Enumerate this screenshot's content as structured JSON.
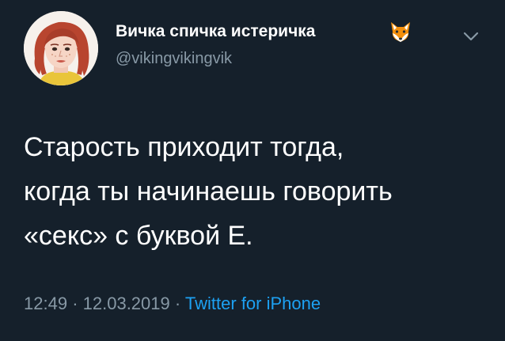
{
  "tweet": {
    "display_name": "Вичка спичка истеричка",
    "name_emoji_icon": "fox-face-icon",
    "username": "@vikingvikingvik",
    "menu_icon": "chevron-down-icon",
    "text_lines": [
      "Старость приходит тогда,",
      "когда ты начинаешь говорить",
      "«секс» с буквой Е."
    ],
    "time": "12:49",
    "separator": "·",
    "date": "12.03.2019",
    "source": "Twitter for iPhone"
  },
  "colors": {
    "background": "#15202b",
    "primary_text": "#ffffff",
    "secondary_text": "#8899a6",
    "link": "#1da1f2"
  }
}
